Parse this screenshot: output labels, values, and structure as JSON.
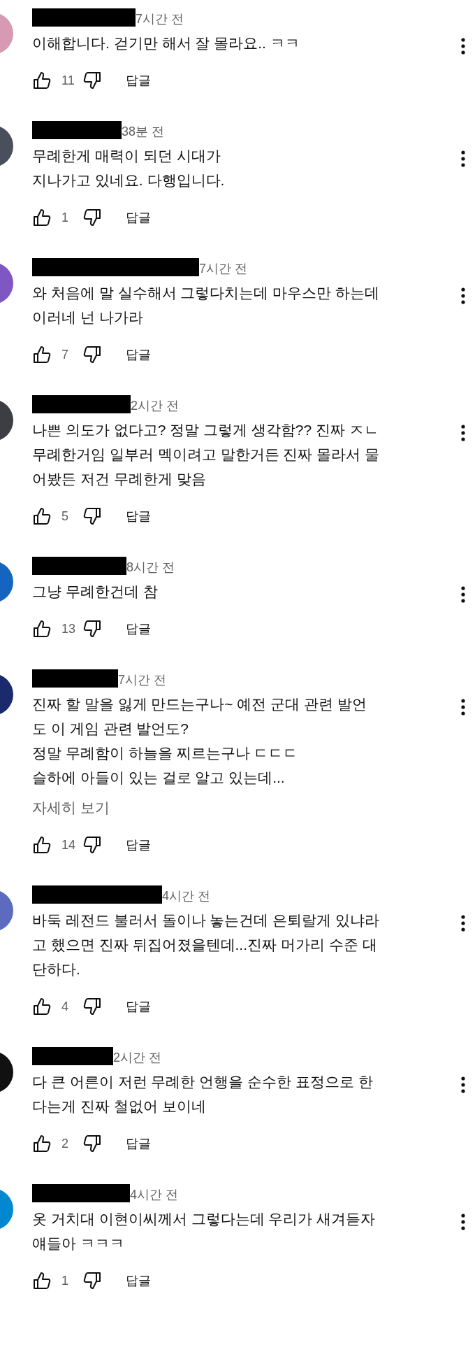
{
  "comments": [
    {
      "color": "#d89ab2",
      "time": "7시간 전",
      "text": "이해합니다. 걷기만 해서 잘 몰라요.. ㅋㅋ",
      "likes": "11",
      "reply": "답글"
    },
    {
      "color": "#4a4f5c",
      "time": "38분 전",
      "text": "무례한게 매력이 되던 시대가\n지나가고 있네요. 다행입니다.",
      "likes": "1",
      "reply": "답글"
    },
    {
      "color": "#7e57c2",
      "time": "7시간 전",
      "text": "와 처음에 말 실수해서 그렇다치는데 마우스만 하는데\n이러네 넌 나가라",
      "likes": "7",
      "reply": "답글"
    },
    {
      "color": "#3d3d44",
      "time": "2시간 전",
      "text": "나쁜 의도가 없다고? 정말 그렇게 생각함?? 진짜 ㅈㄴ\n무례한거임 일부러 멕이려고 말한거든 진짜 몰라서 물\n어봤든 저건 무례한게 맞음",
      "likes": "5",
      "reply": "답글"
    },
    {
      "color": "#1565c0",
      "time": "8시간 전",
      "text": "그냥 무례한건데 참",
      "likes": "13",
      "reply": "답글"
    },
    {
      "color": "#1a2a6c",
      "time": "7시간 전",
      "text": "진짜 할 말을 잃게 만드는구나~ 예전 군대 관련 발언\n도 이 게임 관련 발언도?\n정말 무례함이 하늘을 찌르는구나 ㄷㄷㄷ\n슬하에 아들이 있는 걸로 알고 있는데...",
      "read_more": "자세히 보기",
      "likes": "14",
      "reply": "답글"
    },
    {
      "color": "#5c6bc0",
      "time": "4시간 전",
      "text": "바둑 레전드 불러서 돌이나 놓는건데 은퇴랄게 있냐라\n고 했으면 진짜 뒤집어졌을텐데...진짜 머가리 수준 대\n단하다.",
      "likes": "4",
      "reply": "답글"
    },
    {
      "color": "#111111",
      "time": "2시간 전",
      "text": "다 큰 어른이 저런 무례한 언행을 순수한 표정으로 한\n다는게 진짜 철없어 보이네",
      "likes": "2",
      "reply": "답글"
    },
    {
      "color": "#0288d1",
      "time": "4시간 전",
      "text": "옷 거치대 이현이씨께서 그렇다는데 우리가 새겨듣자\n얘들아 ㅋㅋㅋ",
      "likes": "1",
      "reply": "답글"
    }
  ]
}
